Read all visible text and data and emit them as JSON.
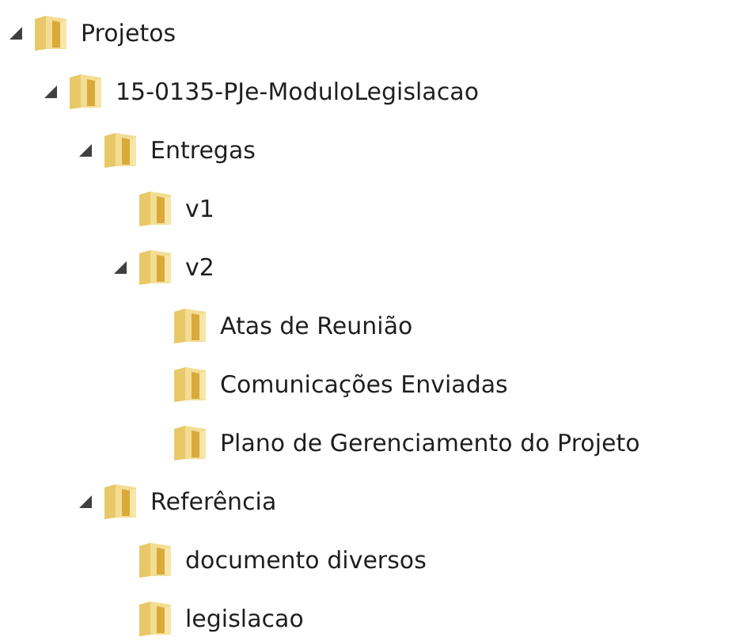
{
  "tree": [
    {
      "label": "Projetos",
      "expanded": true,
      "children": [
        {
          "label": "15-0135-PJe-ModuloLegislacao",
          "expanded": true,
          "children": [
            {
              "label": "Entregas",
              "expanded": true,
              "children": [
                {
                  "label": "v1"
                },
                {
                  "label": "v2",
                  "expanded": true,
                  "children": [
                    {
                      "label": "Atas de Reunião"
                    },
                    {
                      "label": "Comunicações Enviadas"
                    },
                    {
                      "label": "Plano de Gerenciamento do Projeto"
                    }
                  ]
                }
              ]
            },
            {
              "label": "Referência",
              "expanded": true,
              "children": [
                {
                  "label": "documento diversos"
                },
                {
                  "label": "legislacao"
                }
              ]
            }
          ]
        }
      ]
    }
  ]
}
